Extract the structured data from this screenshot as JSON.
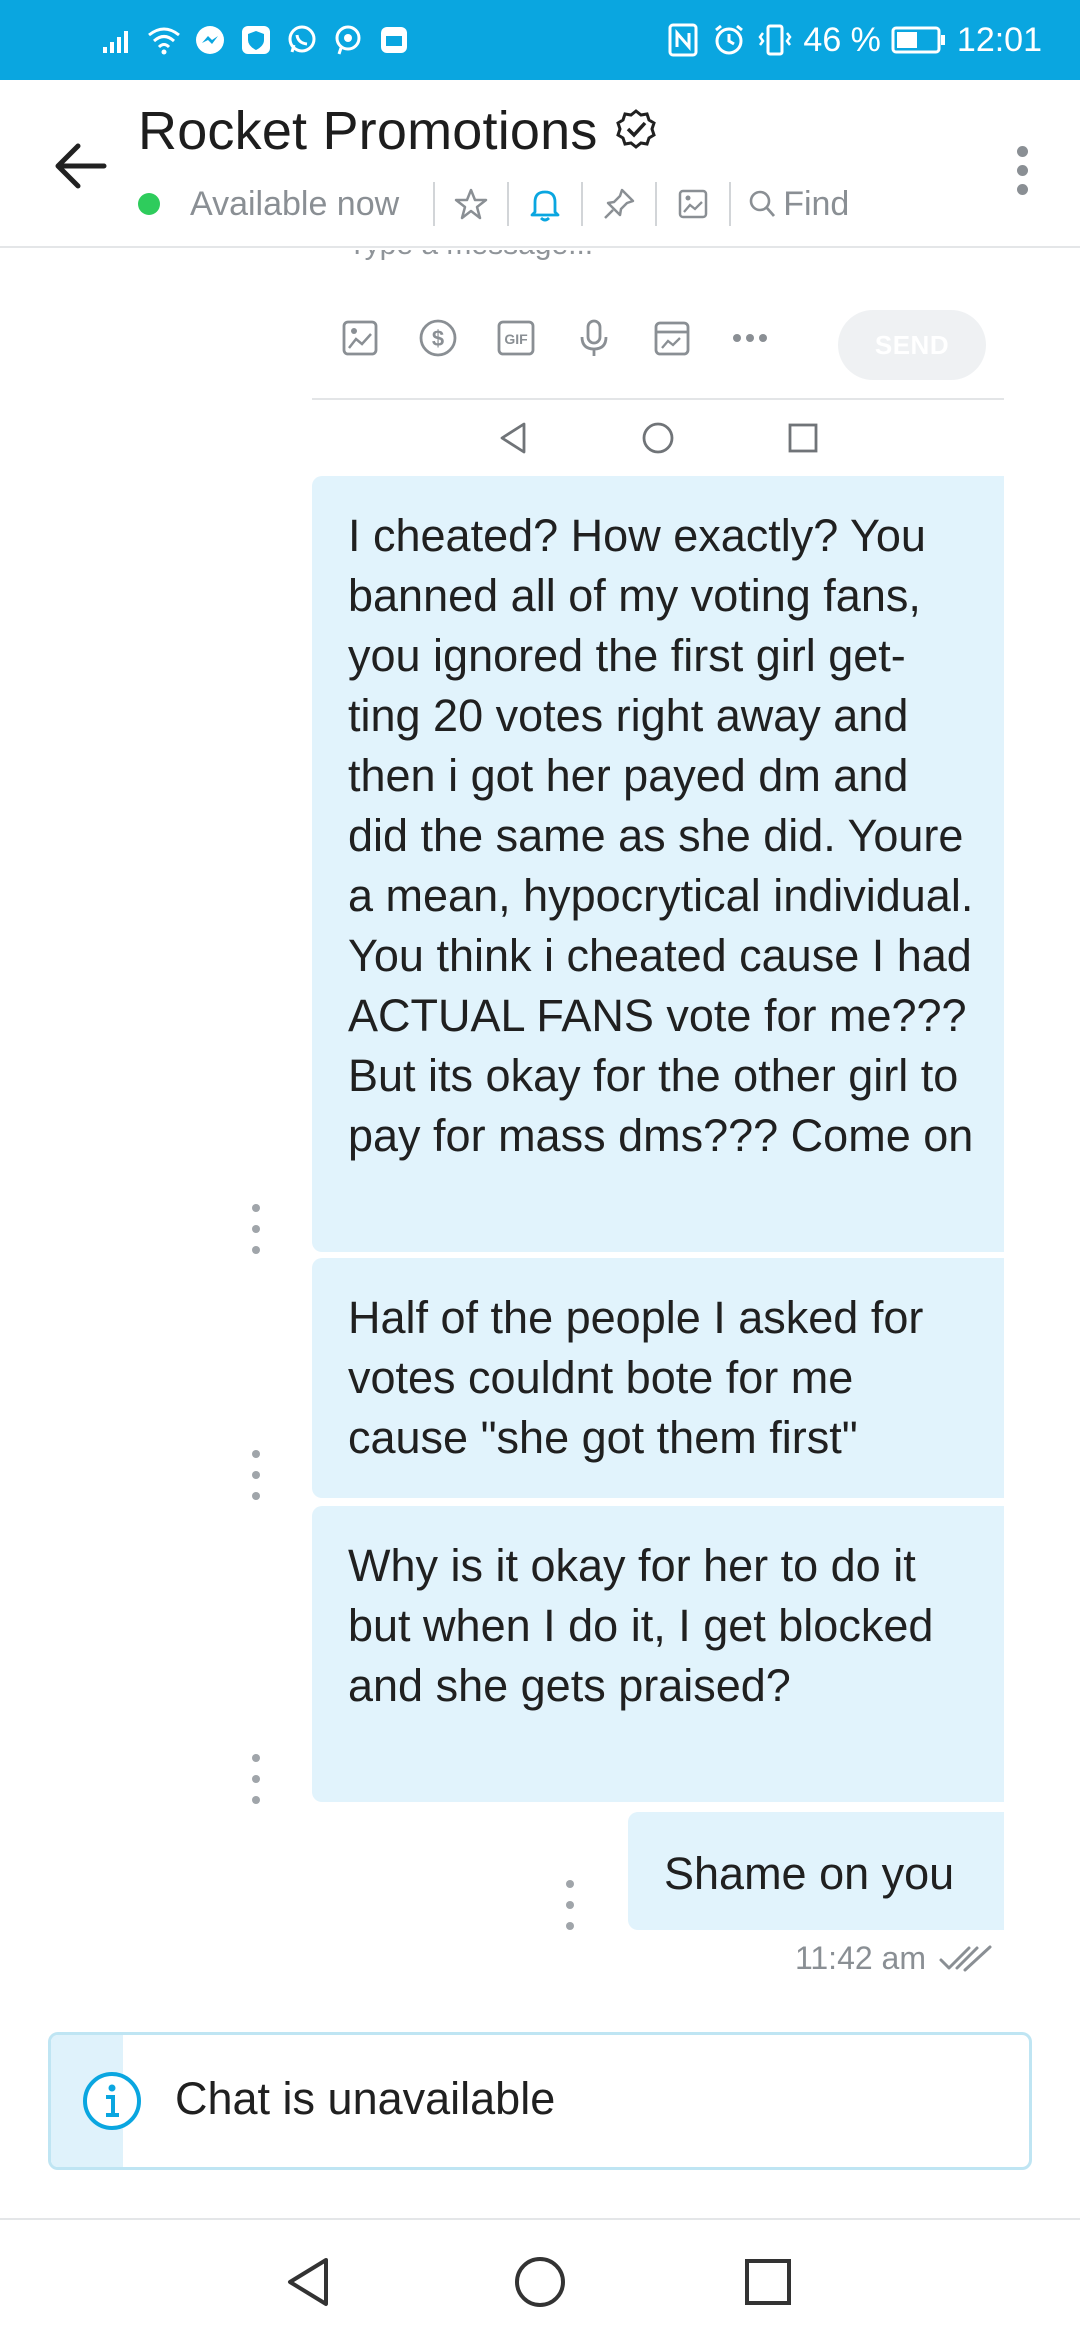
{
  "status_bar": {
    "battery_percent": "46 %",
    "time": "12:01",
    "left_icons": [
      "signal-icon",
      "wifi-icon",
      "messenger-icon",
      "shield-app-icon",
      "whatsapp-icon",
      "chat-app-icon",
      "mail-app-icon"
    ],
    "right_icons": [
      "nfc-icon",
      "alarm-icon",
      "vibrate-icon",
      "battery-icon"
    ]
  },
  "header": {
    "title": "Rocket Promotions",
    "status": "Available now",
    "find_label": "Find",
    "status_color": "#2ecc5c",
    "accent": "#0aa6e0",
    "icons": [
      "star-icon",
      "bell-icon",
      "pin-icon",
      "image-icon",
      "search-icon"
    ]
  },
  "embedded_input": {
    "placeholder": "Type a message...",
    "send_label": "SEND",
    "tools": [
      "image-icon",
      "dollar-icon",
      "gif-icon",
      "mic-icon",
      "calendar-icon",
      "more-icon"
    ]
  },
  "messages": [
    {
      "text": "I cheated? How exactly? You banned all of my voting fans, you ignored the first girl get-ting 20 votes right away and then i got her payed dm and did the same as she did. Youre a mean, hypocrytical individual. You think i cheated cause I had ACTUAL FANS vote for me??? But its okay for the other girl to pay for mass dms??? Come on"
    },
    {
      "text": "Half of the people I asked for votes couldnt bote for me cause \"she got them first\""
    },
    {
      "text": "Why is it okay for her to do it but when I do it, I get blocked and she gets praised?"
    },
    {
      "text": "Shame on you"
    }
  ],
  "last_message_time": "11:42 am",
  "banner": {
    "text": "Chat is unavailable",
    "color": "#0aa6e0"
  }
}
